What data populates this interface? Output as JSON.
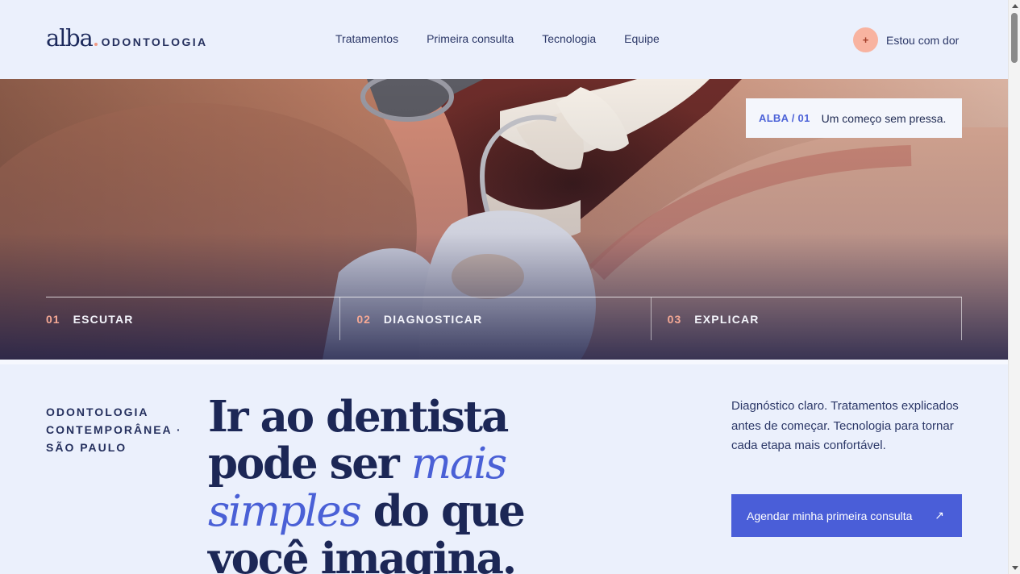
{
  "header": {
    "logo_mark": "alba",
    "logo_sub": "ODONTOLOGIA",
    "nav": [
      "Tratamentos",
      "Primeira consulta",
      "Tecnologia",
      "Equipe"
    ],
    "pain_icon": "+",
    "pain_label": "Estou com dor"
  },
  "hero": {
    "badge_code": "ALBA / 01",
    "badge_text": "Um começo sem pressa.",
    "steps": [
      {
        "num": "01",
        "label": "ESCUTAR"
      },
      {
        "num": "02",
        "label": "DIAGNOSTICAR"
      },
      {
        "num": "03",
        "label": "EXPLICAR"
      }
    ]
  },
  "main": {
    "tagline": "ODONTOLOGIA CONTEMPORÂNEA · SÃO PAULO",
    "headline_part1": "Ir ao dentista pode ser ",
    "headline_em": "mais simples",
    "headline_part2": " do que você imagina.",
    "description": "Diagnóstico claro. Tratamentos explicados antes de começar. Tecnologia para tornar cada etapa mais confortável.",
    "cta_label": "Agendar minha primeira consulta",
    "cta_arrow": "↗"
  },
  "colors": {
    "background": "#ebf0fc",
    "accent": "#4a5ed8",
    "coral": "#f8b3a0",
    "navy": "#1c2756"
  },
  "icons": {
    "pain": "plus-icon",
    "cta": "arrow-up-right-icon"
  }
}
